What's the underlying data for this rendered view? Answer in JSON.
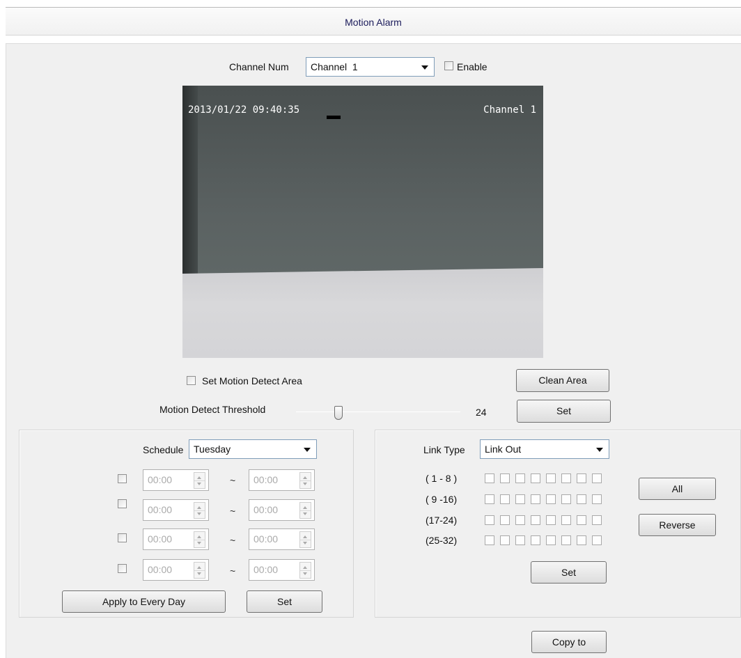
{
  "window": {
    "title": "Motion Alarm"
  },
  "channel": {
    "label": "Channel Num",
    "selected": "Channel  1",
    "enable_label": "Enable"
  },
  "video": {
    "timestamp": "2013/01/22 09:40:35",
    "channel_overlay": "Channel 1"
  },
  "motion": {
    "set_area_label": "Set Motion Detect Area",
    "clean_area_button": "Clean Area",
    "threshold_label": "Motion Detect Threshold",
    "threshold_value": "24",
    "threshold_set_button": "Set"
  },
  "schedule": {
    "label": "Schedule",
    "selected_day": "Tuesday",
    "separator": "~",
    "rows": [
      {
        "start": "00:00",
        "end": "00:00"
      },
      {
        "start": "00:00",
        "end": "00:00"
      },
      {
        "start": "00:00",
        "end": "00:00"
      },
      {
        "start": "00:00",
        "end": "00:00"
      }
    ],
    "apply_button": "Apply to Every Day",
    "set_button": "Set"
  },
  "link": {
    "label": "Link Type",
    "selected": "Link Out",
    "ranges": [
      "( 1 - 8 )",
      "( 9 -16)",
      "(17-24)",
      "(25-32)"
    ],
    "all_button": "All",
    "reverse_button": "Reverse",
    "set_button": "Set"
  },
  "footer": {
    "copy_button": "Copy to"
  },
  "icons": [
    "chevron-down-icon",
    "spin-up-icon",
    "spin-down-icon",
    "slider-thumb"
  ]
}
